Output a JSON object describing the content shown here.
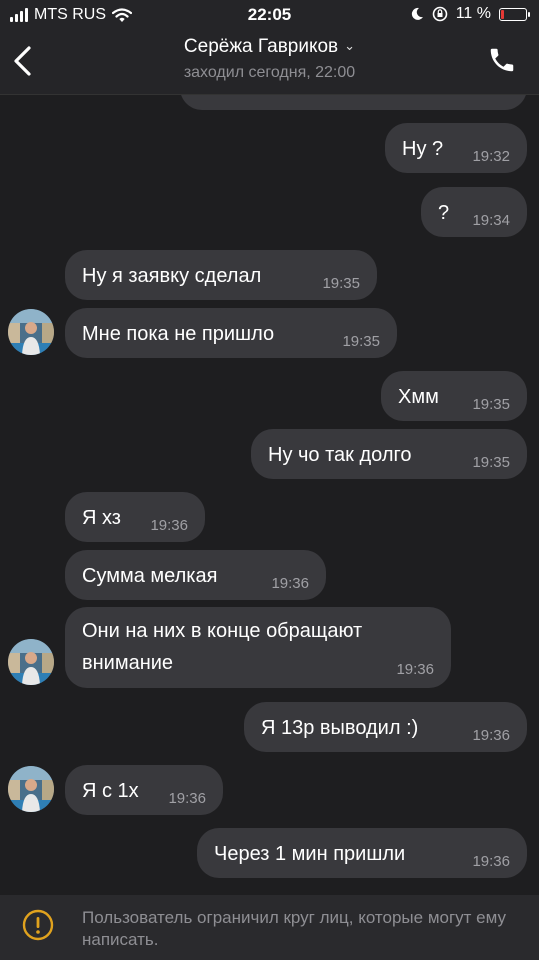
{
  "status_bar": {
    "carrier": "MTS RUS",
    "time": "22:05",
    "battery_percent": "11 %",
    "battery_level": 0.11,
    "signal_icon": "signal-bars-icon",
    "wifi_icon": "wifi-icon",
    "moon_icon": "moon-icon",
    "orientation_lock_icon": "rotation-lock-icon"
  },
  "header": {
    "back_icon": "chevron-left-icon",
    "contact_name": "Серёжа Гавриков",
    "name_chevron": "⌄",
    "last_seen": "заходил сегодня, 22:00",
    "call_icon": "phone-icon"
  },
  "messages": [
    {
      "id": 0,
      "side": "out",
      "text": "Ну ?",
      "time": "19:32"
    },
    {
      "id": 1,
      "side": "out",
      "text": "?",
      "time": "19:34"
    },
    {
      "id": 2,
      "side": "in",
      "text": "Ну я заявку сделал",
      "time": "19:35"
    },
    {
      "id": 3,
      "side": "in",
      "text": "Мне пока не пришло",
      "time": "19:35"
    },
    {
      "id": 4,
      "side": "out",
      "text": "Хмм",
      "time": "19:35"
    },
    {
      "id": 5,
      "side": "out",
      "text": "Ну чо так долго",
      "time": "19:35"
    },
    {
      "id": 6,
      "side": "in",
      "text": "Я хз",
      "time": "19:36"
    },
    {
      "id": 7,
      "side": "in",
      "text": "Сумма мелкая",
      "time": "19:36"
    },
    {
      "id": 8,
      "side": "in",
      "text_line1": "Они на них в конце обращают",
      "text_line2": "внимание",
      "time": "19:36"
    },
    {
      "id": 9,
      "side": "out",
      "text": "Я 13р выводил :)",
      "time": "19:36"
    },
    {
      "id": 10,
      "side": "in",
      "text": "Я с 1х",
      "time": "19:36"
    },
    {
      "id": 11,
      "side": "out",
      "text": "Через 1 мин пришли",
      "time": "19:36"
    }
  ],
  "footer": {
    "warning_icon": "warning-icon",
    "notice": "Пользователь ограничил круг лиц, которые могут ему написать."
  },
  "colors": {
    "background": "#1e1e20",
    "bubble": "#39393d",
    "header": "#252528",
    "link": "#4a90e2",
    "battery_low": "#e53935",
    "warning": "#e0a21e"
  }
}
